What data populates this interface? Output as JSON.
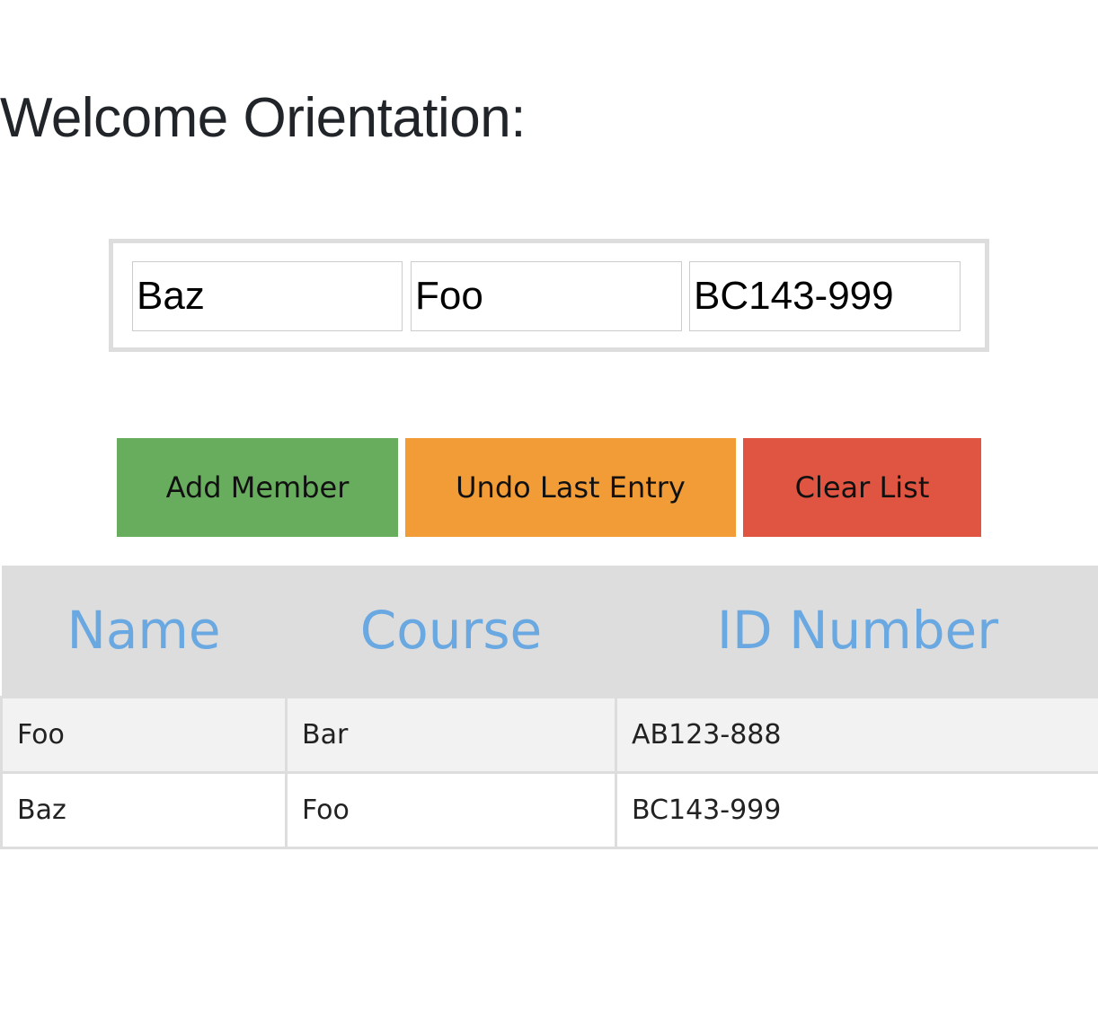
{
  "page": {
    "title": "Welcome Orientation:"
  },
  "form": {
    "name_value": "Baz",
    "course_value": "Foo",
    "id_value": "BC143-999"
  },
  "buttons": {
    "add_label": "Add Member",
    "undo_label": "Undo Last Entry",
    "clear_label": "Clear List"
  },
  "colors": {
    "add": "#68ad5e",
    "undo": "#f19c37",
    "clear": "#e05542",
    "header_text": "#6aa8e2",
    "header_bg": "#dddddd"
  },
  "table": {
    "headers": [
      "Name",
      "Course",
      "ID Number"
    ],
    "rows": [
      [
        "Foo",
        "Bar",
        "AB123-888"
      ],
      [
        "Baz",
        "Foo",
        "BC143-999"
      ]
    ]
  }
}
